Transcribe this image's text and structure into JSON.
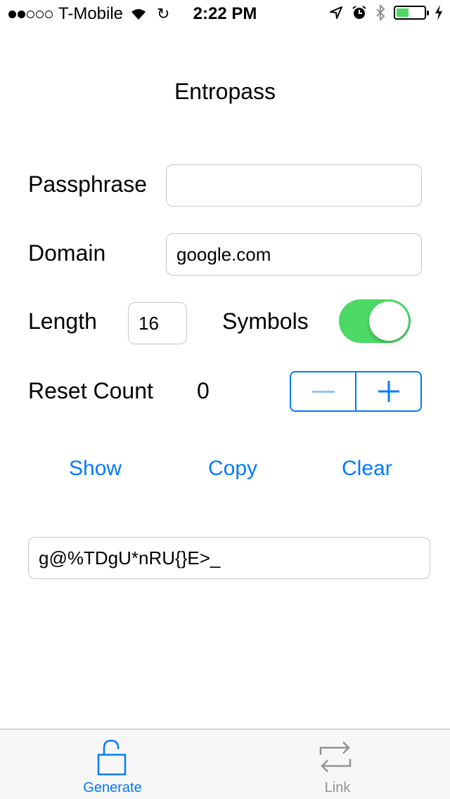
{
  "status_bar": {
    "carrier": "T-Mobile",
    "time": "2:22 PM",
    "signal_bars": 2,
    "battery_level": 0.45,
    "battery_color": "#4cd964"
  },
  "app": {
    "title": "Entropass"
  },
  "form": {
    "passphrase_label": "Passphrase",
    "passphrase_value": "",
    "domain_label": "Domain",
    "domain_value": "google.com",
    "length_label": "Length",
    "length_value": "16",
    "symbols_label": "Symbols",
    "symbols_on": true,
    "reset_count_label": "Reset Count",
    "reset_count_value": "0"
  },
  "stepper": {
    "minus_icon": "minus-icon",
    "plus_icon": "plus-icon",
    "accent": "#007aff"
  },
  "actions": {
    "show": "Show",
    "copy": "Copy",
    "clear": "Clear"
  },
  "output": {
    "password": "g@%TDgU*nRU{}E>_"
  },
  "tabs": [
    {
      "label": "Generate",
      "icon": "unlock-icon",
      "active": true
    },
    {
      "label": "Link",
      "icon": "link-arrows-icon",
      "active": false
    }
  ],
  "colors": {
    "accent": "#007aff",
    "toggle_on": "#4cd964",
    "inactive_tab": "#929292"
  }
}
